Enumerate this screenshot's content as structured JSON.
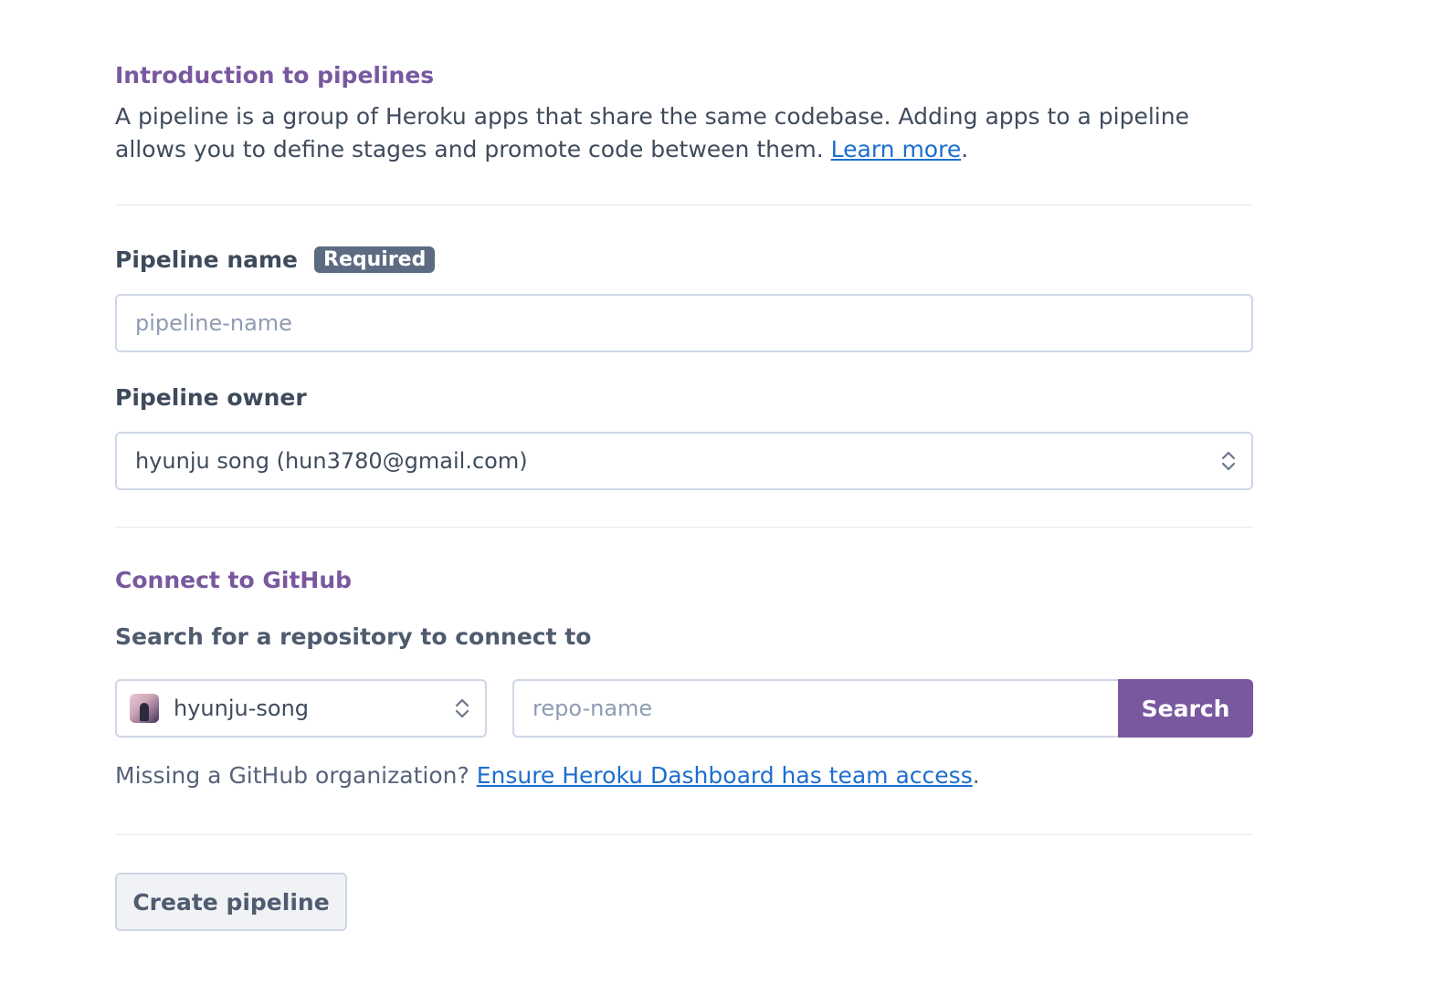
{
  "intro": {
    "title": "Introduction to pipelines",
    "text": "A pipeline is a group of Heroku apps that share the same codebase. Adding apps to a pipeline allows you to define stages and promote code between them.",
    "link_label": "Learn more",
    "trailing": "."
  },
  "pipeline_name": {
    "label": "Pipeline name",
    "badge": "Required",
    "placeholder": "pipeline-name",
    "value": ""
  },
  "pipeline_owner": {
    "label": "Pipeline owner",
    "selected": "hyunju song (hun3780@gmail.com)"
  },
  "github": {
    "title": "Connect to GitHub",
    "search_label": "Search for a repository to connect to",
    "org_selected": "hyunju-song",
    "repo_placeholder": "repo-name",
    "repo_value": "",
    "search_button": "Search",
    "missing_text": "Missing a GitHub organization?",
    "missing_link": "Ensure Heroku Dashboard has team access",
    "missing_trailing": "."
  },
  "actions": {
    "create_button": "Create pipeline"
  },
  "colors": {
    "accent": "#79589f",
    "link": "#1c6ecf",
    "text": "#3f4b5c",
    "badge_bg": "#5d6b82"
  },
  "icons": {
    "select_chevrons": "chevron-up-down-icon",
    "org_avatar": "avatar"
  }
}
